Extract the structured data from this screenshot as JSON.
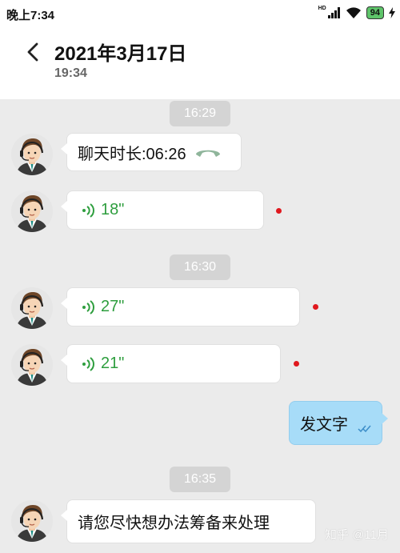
{
  "status_bar": {
    "time": "晚上7:34",
    "network_label": "HD",
    "battery": "94"
  },
  "header": {
    "title": "2021年3月17日",
    "subtitle": "19:34"
  },
  "messages": [
    {
      "type": "timestamp",
      "text": "16:29"
    },
    {
      "type": "call",
      "direction": "in",
      "text": "聊天时长:06:26"
    },
    {
      "type": "voice",
      "direction": "in",
      "duration": "18\"",
      "unread": true
    },
    {
      "type": "timestamp",
      "text": "16:30"
    },
    {
      "type": "voice",
      "direction": "in",
      "duration": "27\"",
      "unread": true
    },
    {
      "type": "voice",
      "direction": "in",
      "duration": "21\"",
      "unread": true
    },
    {
      "type": "text",
      "direction": "out",
      "text": "发文字",
      "status": "read"
    },
    {
      "type": "timestamp",
      "text": "16:35"
    },
    {
      "type": "text",
      "direction": "in",
      "text": "请您尽快想办法筹备来处理"
    }
  ],
  "watermark": "知乎 @11月",
  "colors": {
    "voice_green": "#2e9e3e",
    "unread_red": "#e0181e",
    "out_bubble": "#a7dcf8",
    "timestamp_bg": "#d4d4d4"
  },
  "icons": [
    "back-arrow-icon",
    "voice-wave-icon",
    "phone-hangup-icon",
    "double-check-icon",
    "signal-icon",
    "wifi-icon",
    "battery-icon",
    "charging-icon"
  ]
}
